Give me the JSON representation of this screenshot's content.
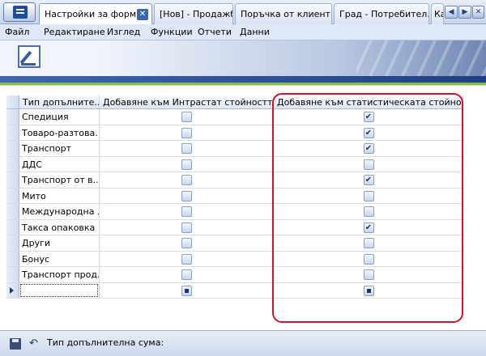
{
  "tabs": [
    {
      "label": "Настройки за форм...",
      "active": true
    },
    {
      "label": "[Нов] - Продажба",
      "active": false
    },
    {
      "label": "Поръчка от клиент...",
      "active": false
    },
    {
      "label": "Град - Потребител...",
      "active": false
    },
    {
      "label": "Ка",
      "active": false
    }
  ],
  "tab_close_glyph": "✕",
  "nav": {
    "prev": "◀",
    "next": "▶",
    "close": "✕"
  },
  "menu": [
    "Файл",
    "Редактиране",
    "Изглед",
    "Функции",
    "Отчети",
    "Данни"
  ],
  "grid": {
    "columns": [
      "Тип допълните...",
      "Добавяне към Интрастат стойността",
      "Добавяне към статистическата стойност"
    ],
    "rows": [
      {
        "type": "Спедиция",
        "intrastat": false,
        "statistical": true
      },
      {
        "type": "Товаро-разтова...",
        "intrastat": false,
        "statistical": true
      },
      {
        "type": "Транспорт",
        "intrastat": false,
        "statistical": true
      },
      {
        "type": "ДДС",
        "intrastat": false,
        "statistical": false
      },
      {
        "type": "Транспорт от в...",
        "intrastat": false,
        "statistical": true
      },
      {
        "type": "Мито",
        "intrastat": false,
        "statistical": false
      },
      {
        "type": "Международна ...",
        "intrastat": false,
        "statistical": false
      },
      {
        "type": "Такса опаковка",
        "intrastat": false,
        "statistical": true
      },
      {
        "type": "Други",
        "intrastat": false,
        "statistical": false
      },
      {
        "type": "Бонус",
        "intrastat": false,
        "statistical": false
      },
      {
        "type": "Транспорт прод...",
        "intrastat": false,
        "statistical": false
      }
    ]
  },
  "status": {
    "label": "Тип допълнителна сума:"
  },
  "colors": {
    "highlight": "#d0142c",
    "accent": "#1e3f87",
    "green_stripe": "#8bbf3a"
  },
  "icons": {
    "save": "save-icon",
    "undo": "undo-icon",
    "app": "app-menu-icon"
  }
}
